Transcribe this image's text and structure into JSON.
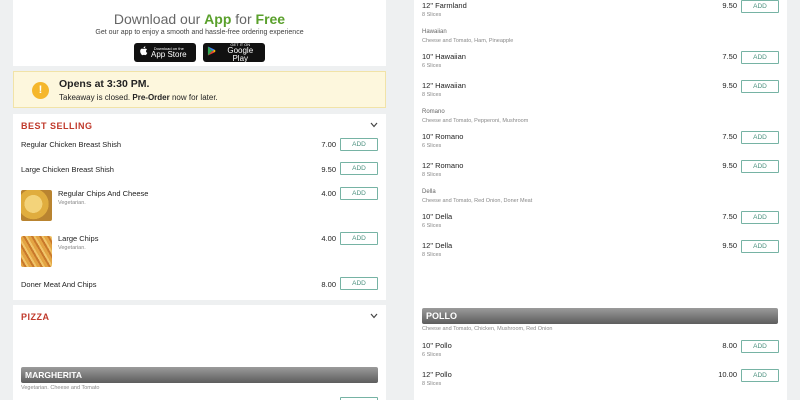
{
  "promo": {
    "title_prefix": "Download our ",
    "title_app": "App",
    "title_mid": " for ",
    "title_free": "Free",
    "subtitle": "Get our app to enjoy a smooth and hassle-free ordering experience",
    "app_store_small": "Download on the",
    "app_store_big": "App Store",
    "google_play_small": "GET IT ON",
    "google_play_big": "Google Play"
  },
  "notice": {
    "icon": "!",
    "title": "Opens at 3:30 PM.",
    "text_before": "Takeaway is closed. ",
    "text_bold": "Pre-Order",
    "text_after": " now for later."
  },
  "best_selling": {
    "heading": "BEST SELLING",
    "items": [
      {
        "name": "Regular Chicken Breast Shish",
        "price": "7.00",
        "add": "ADD"
      },
      {
        "name": "Large Chicken Breast Shish",
        "price": "9.50",
        "add": "ADD"
      },
      {
        "name": "Regular Chips And Cheese",
        "desc": "Vegetarian.",
        "price": "4.00",
        "add": "ADD"
      },
      {
        "name": "Large Chips",
        "desc": "Vegetarian.",
        "price": "4.00",
        "add": "ADD"
      },
      {
        "name": "Doner Meat And Chips",
        "price": "8.00",
        "add": "ADD"
      }
    ]
  },
  "pizza": {
    "heading": "PIZZA",
    "bar_title": "MARGHERITA",
    "bar_desc": "Vegetarian. Cheese and Tomato"
  },
  "right": {
    "items": [
      {
        "name": "12\" Farmland",
        "sub": "8 Slices",
        "price": "9.50",
        "add": "ADD"
      },
      {
        "name": "10\" Hawaiian",
        "sub": "6 Slices",
        "price": "7.50",
        "add": "ADD"
      },
      {
        "name": "12\" Hawaiian",
        "sub": "8 Slices",
        "price": "9.50",
        "add": "ADD"
      },
      {
        "name": "10\" Romano",
        "sub": "6 Slices",
        "price": "7.50",
        "add": "ADD"
      },
      {
        "name": "12\" Romano",
        "sub": "8 Slices",
        "price": "9.50",
        "add": "ADD"
      },
      {
        "name": "10\" Della",
        "sub": "6 Slices",
        "price": "7.50",
        "add": "ADD"
      },
      {
        "name": "12\" Della",
        "sub": "8 Slices",
        "price": "9.50",
        "add": "ADD"
      },
      {
        "name": "10\" Pollo",
        "sub": "6 Slices",
        "price": "8.00",
        "add": "ADD"
      },
      {
        "name": "12\" Pollo",
        "sub": "8 Slices",
        "price": "10.00",
        "add": "ADD"
      }
    ],
    "groups": [
      {
        "title": "Hawaiian",
        "desc": "Cheese and Tomato, Ham, Pineapple"
      },
      {
        "title": "Romano",
        "desc": "Cheese and Tomato, Pepperoni, Mushroom"
      },
      {
        "title": "Della",
        "desc": "Cheese and Tomato, Red Onion, Doner Meat"
      }
    ],
    "pollo_bar": {
      "title": "POLLO",
      "desc": "Cheese and Tomato, Chicken, Mushroom, Red Onion"
    }
  },
  "colors": {
    "accent_green": "#5aa02c",
    "section_red": "#c0392b",
    "add_border": "#76b3a4",
    "notice_bg": "#fdf7dd",
    "notice_icon": "#f5b72c"
  },
  "icons": {
    "notice": "exclamation-icon",
    "section_toggle": "chevron-down-icon",
    "app_store": "apple-icon",
    "google_play": "play-icon"
  }
}
